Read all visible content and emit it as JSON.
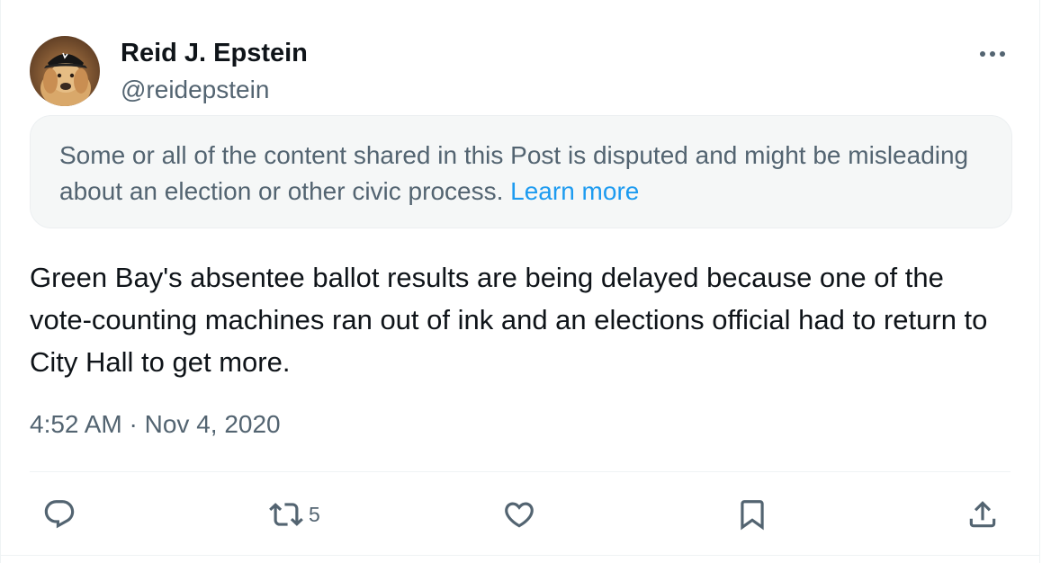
{
  "author": {
    "display_name": "Reid J. Epstein",
    "handle": "@reidepstein",
    "avatar_icon": "dog-avatar"
  },
  "notice": {
    "text": "Some or all of the content shared in this Post is disputed and might be misleading about an election or other civic process. ",
    "link_label": "Learn more",
    "link_color": "#1d9bf0"
  },
  "post": {
    "text": "Green Bay's absentee ballot results are being delayed because one of the vote-counting machines ran out of ink and an elections official had to return to City Hall to get more.",
    "time": "4:52 AM",
    "separator": "·",
    "date": "Nov 4, 2020"
  },
  "actions": {
    "reply": {
      "icon": "reply-icon",
      "count": ""
    },
    "repost": {
      "icon": "repost-icon",
      "count": "5"
    },
    "like": {
      "icon": "like-icon",
      "count": ""
    },
    "bookmark": {
      "icon": "bookmark-icon",
      "count": ""
    },
    "share": {
      "icon": "share-icon",
      "count": ""
    }
  },
  "colors": {
    "text_primary": "#0f1419",
    "text_secondary": "#536471",
    "accent": "#1d9bf0",
    "notice_bg": "#f5f7f7"
  }
}
